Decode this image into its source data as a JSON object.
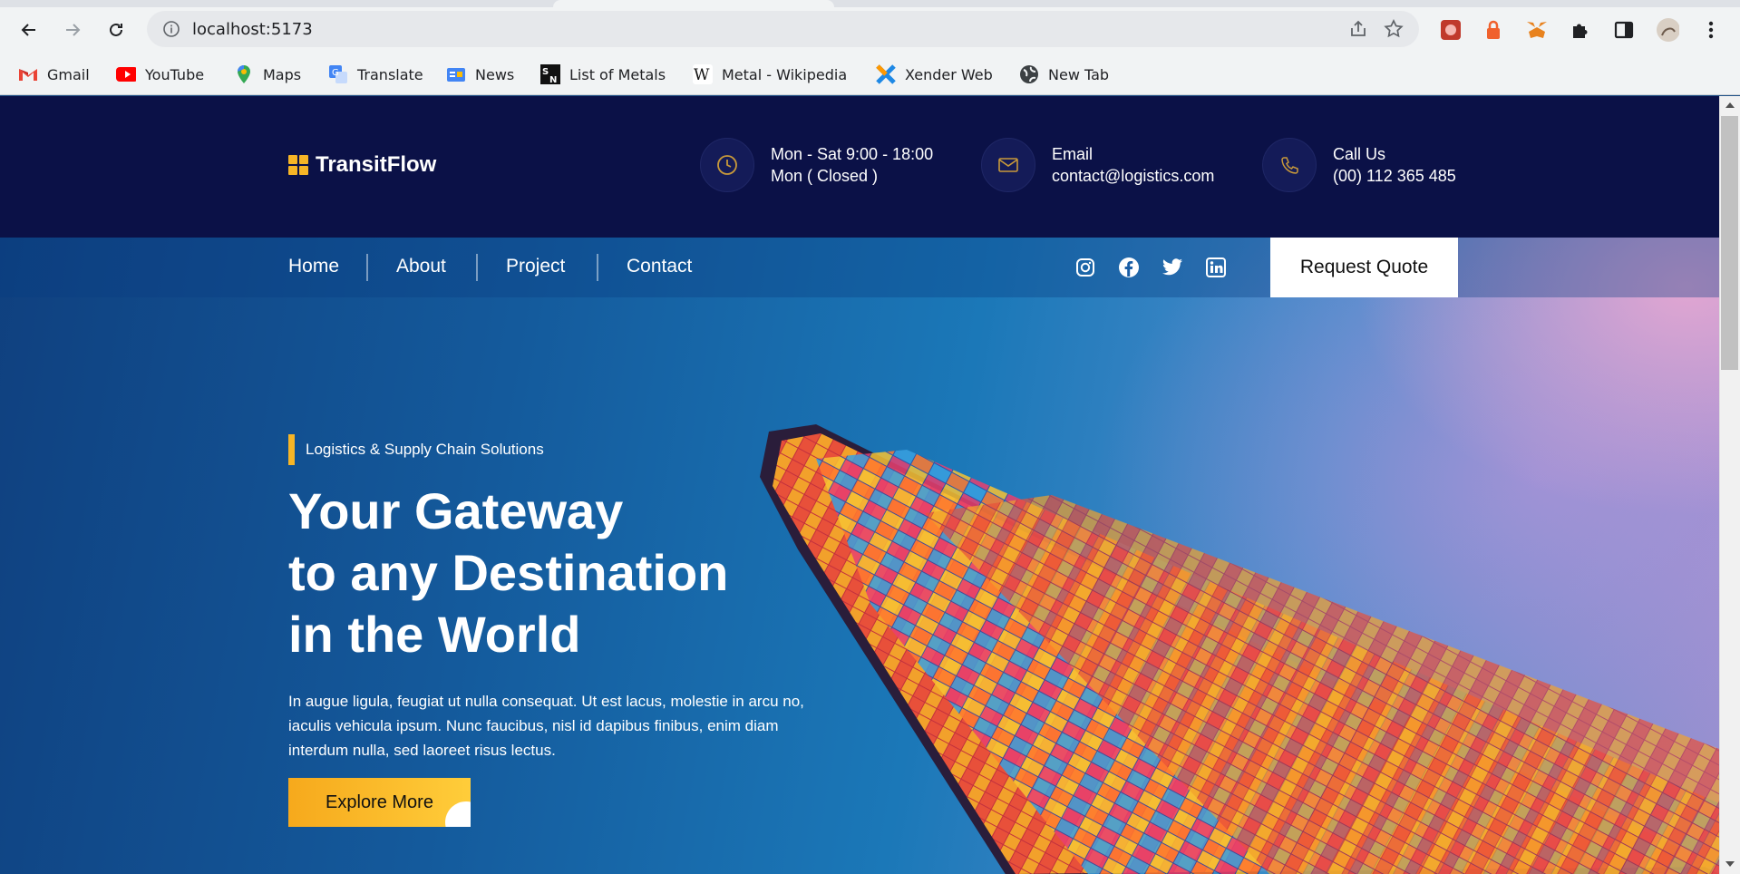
{
  "browser": {
    "url": "localhost:5173",
    "bookmarks": [
      {
        "label": "Gmail",
        "icon": "gmail-icon"
      },
      {
        "label": "YouTube",
        "icon": "youtube-icon"
      },
      {
        "label": "Maps",
        "icon": "maps-icon"
      },
      {
        "label": "Translate",
        "icon": "translate-icon"
      },
      {
        "label": "News",
        "icon": "news-icon"
      },
      {
        "label": "List of Metals",
        "icon": "sn-icon"
      },
      {
        "label": "Metal - Wikipedia",
        "icon": "wikipedia-icon"
      },
      {
        "label": "Xender Web",
        "icon": "xender-icon"
      },
      {
        "label": "New Tab",
        "icon": "globe-icon"
      }
    ]
  },
  "site": {
    "brand": "TransitFlow",
    "hours": {
      "line1": "Mon - Sat 9:00 - 18:00",
      "line2": "Mon ( Closed )"
    },
    "email": {
      "label": "Email",
      "value": "contact@logistics.com"
    },
    "phone": {
      "label": "Call Us",
      "value": "(00) 112 365 485"
    },
    "nav": [
      "Home",
      "About",
      "Project",
      "Contact"
    ],
    "quote_button": "Request Quote",
    "social": [
      "instagram-icon",
      "facebook-icon",
      "twitter-icon",
      "linkedin-icon"
    ]
  },
  "hero": {
    "tagline": "Logistics & Supply Chain Solutions",
    "headline": [
      "Your Gateway",
      "to any Destination",
      "in the World"
    ],
    "description": "In augue ligula, feugiat ut nulla consequat. Ut est lacus, molestie in arcu no, iaculis vehicula ipsum. Nunc faucibus, nisl id dapibus finibus, enim diam interdum nulla, sed laoreet risus lectus.",
    "cta": "Explore More"
  },
  "colors": {
    "accent": "#f7b526",
    "header_bg": "#0b1147"
  }
}
